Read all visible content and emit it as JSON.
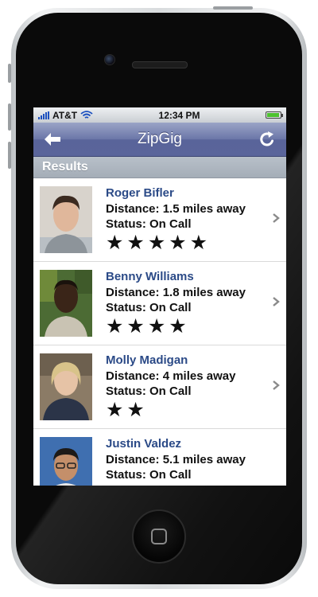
{
  "status_bar": {
    "carrier": "AT&T",
    "time": "12:34 PM",
    "battery_icon": "battery-icon",
    "wifi_icon": "wifi-icon"
  },
  "nav": {
    "title": "ZipGig",
    "back_icon": "back-arrow-icon",
    "refresh_icon": "refresh-icon"
  },
  "section_header": "Results",
  "results": [
    {
      "name": "Roger Bifler",
      "distance": "Distance: 1.5 miles away",
      "status": "Status: On Call",
      "rating": 5,
      "stars": "★★★★★"
    },
    {
      "name": "Benny Williams",
      "distance": "Distance: 1.8 miles away",
      "status": "Status: On Call",
      "rating": 4,
      "stars": "★★★★"
    },
    {
      "name": "Molly Madigan",
      "distance": "Distance: 4 miles away",
      "status": "Status: On Call",
      "rating": 2,
      "stars": "★★"
    },
    {
      "name": "Justin Valdez",
      "distance": "Distance: 5.1 miles away",
      "status": "Status: On Call",
      "rating": null,
      "stars": ""
    }
  ]
}
